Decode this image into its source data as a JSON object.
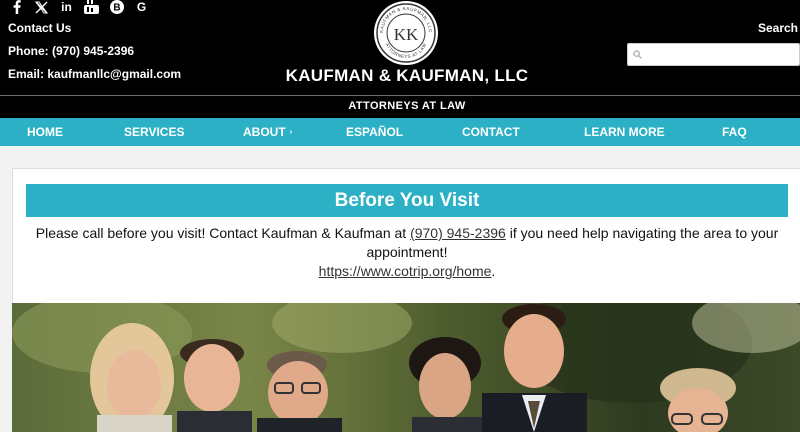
{
  "social": {
    "icons": [
      "facebook-icon",
      "x-icon",
      "linkedin-icon",
      "youtube-icon",
      "blogger-icon",
      "google-icon"
    ],
    "linkedin_text": "in",
    "google_text": "G"
  },
  "contact": {
    "heading": "Contact Us",
    "phone": "Phone: (970) 945-2396",
    "email": "Email: kaufmanllc@gmail.com"
  },
  "logo": {
    "monogram": "KK",
    "seal_text": "KAUFMAN & KAUFMAN, LLC · ATTORNEYS AT LAW"
  },
  "firm": {
    "name": "KAUFMAN & KAUFMAN, LLC",
    "tagline": "ATTORNEYS AT LAW"
  },
  "search": {
    "label": "Search",
    "placeholder": ""
  },
  "nav": {
    "items": [
      "HOME",
      "SERVICES",
      "ABOUT",
      "ESPAÑOL",
      "CONTACT",
      "LEARN MORE",
      "FAQ"
    ],
    "about_caret": "›"
  },
  "notice": {
    "title": "Before You Visit",
    "text_before": "Please call before you visit! Contact Kaufman & Kaufman at",
    "phone_link": "(970) 945-2396",
    "text_after": "if you need help navigating the area to your appointment!",
    "url_link": "https://www.cotrip.org/home",
    "url_suffix": "."
  },
  "colors": {
    "header_bg": "#000000",
    "accent": "#2bb0c6",
    "content_bg": "#f2f2f2"
  }
}
